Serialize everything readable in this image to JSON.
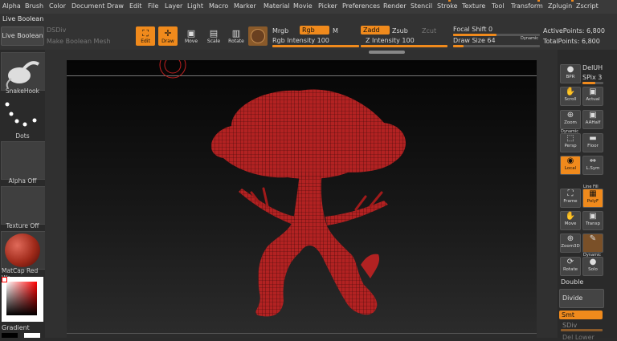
{
  "menu": [
    "Alpha",
    "Brush",
    "Color",
    "Document",
    "Draw",
    "Edit",
    "File",
    "Layer",
    "Light",
    "Macro",
    "Marker",
    "Material",
    "Movie",
    "Picker",
    "Preferences",
    "Render",
    "Stencil",
    "Stroke",
    "Texture",
    "Tool",
    "Transform",
    "Zplugin",
    "Zscript"
  ],
  "shelf": {
    "title": "Live Boolean",
    "live_boolean_btn": "Live Boolean",
    "dsdiv": "DSDiv",
    "make_boolean": "Make Boolean Mesh",
    "edit": "Edit",
    "draw": "Draw",
    "move": "Move",
    "scale": "Scale",
    "rotate": "Rotate",
    "mrgb": "Mrgb",
    "rgb": "Rgb",
    "m": "M",
    "rgb_intensity": "Rgb Intensity 100",
    "zadd": "Zadd",
    "zsub": "Zsub",
    "zcut": "Zcut",
    "z_intensity": "Z Intensity 100",
    "focal_shift": "Focal Shift 0",
    "draw_size": "Draw Size 64",
    "dynamic": "Dynamic",
    "active_points": "ActivePoints: 6,800",
    "total_points": "TotalPoints: 6,800"
  },
  "sliders": {
    "rgb_intensity": 1.0,
    "z_intensity": 1.0,
    "focal_shift": 0.5,
    "draw_size": 0.12
  },
  "left": {
    "brush": "SnakeHook",
    "stroke": "Dots",
    "alpha": "Alpha Off",
    "texture": "Texture Off",
    "material": "MatCap Red Wa",
    "gradient": "Gradient"
  },
  "right": {
    "bpr": "BPR",
    "deluh": "DelUH",
    "spix": "SPix 3",
    "scroll": "Scroll",
    "actual": "Actual",
    "zoom": "Zoom",
    "aahalf": "AAHalf",
    "dynamic": "Dynamic",
    "persp": "Persp",
    "floor": "Floor",
    "local": "Local",
    "lsym": "L.Sym",
    "frame": "Frame",
    "polyf": "PolyF",
    "line_fill": "Line Fill",
    "move": "Move",
    "transp": "Transp",
    "zoom3d": "Zoom3D",
    "ghost": "Ghost",
    "rotate": "Rotate",
    "solo": "Solo",
    "dynamic2": "Dynamic",
    "double": "Double",
    "divide": "Divide",
    "smt": "Smt",
    "sdiv": "SDiv",
    "del_lower": "Del Lower"
  },
  "colors": {
    "accent": "#f08a1c",
    "mesh": "#b22222",
    "wire": "#3a0808"
  }
}
